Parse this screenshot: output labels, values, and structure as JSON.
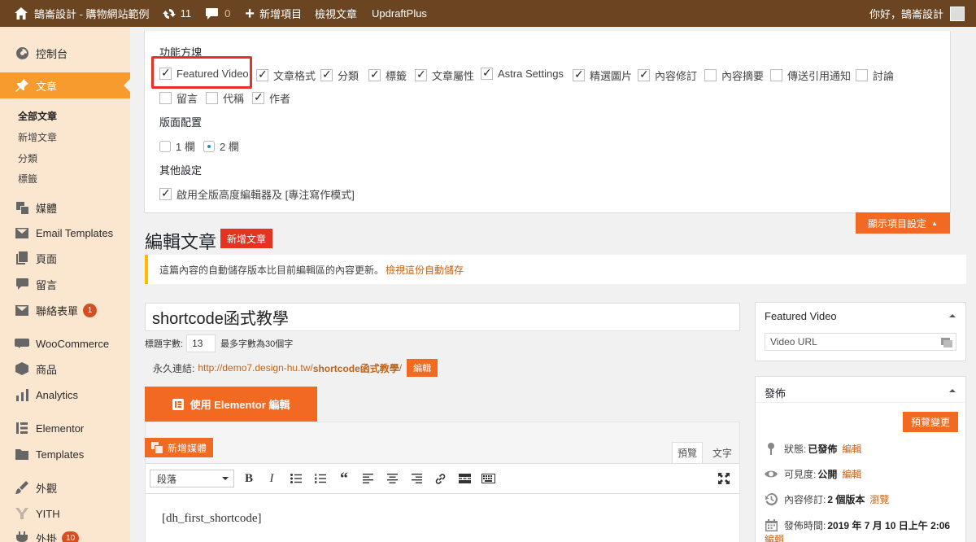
{
  "admin_bar": {
    "site_name": "鵠崙設計 - 購物網站範例",
    "updates_count": "11",
    "comments_count": "0",
    "new_label": "新增項目",
    "view_post_label": "檢視文章",
    "updraft_label": "UpdraftPlus",
    "greeting": "你好，鵠崙設計"
  },
  "sidebar": {
    "items": [
      {
        "label": "控制台",
        "icon": "dashboard-icon"
      },
      {
        "label": "文章",
        "icon": "pin-icon"
      },
      {
        "label": "媒體",
        "icon": "media-icon"
      },
      {
        "label": "Email Templates",
        "icon": "email-icon"
      },
      {
        "label": "頁面",
        "icon": "page-icon"
      },
      {
        "label": "留言",
        "icon": "comment-icon"
      },
      {
        "label": "聯絡表單",
        "icon": "mail-icon",
        "badge": "1"
      },
      {
        "label": "WooCommerce",
        "icon": "woo-icon"
      },
      {
        "label": "商品",
        "icon": "box-icon"
      },
      {
        "label": "Analytics",
        "icon": "bar-chart-icon"
      },
      {
        "label": "Elementor",
        "icon": "elementor-icon"
      },
      {
        "label": "Templates",
        "icon": "folder-icon"
      },
      {
        "label": "外觀",
        "icon": "brush-icon"
      },
      {
        "label": "YITH",
        "icon": "yith-icon"
      },
      {
        "label": "外掛",
        "icon": "plugin-icon",
        "badge": "10"
      }
    ],
    "submenu": [
      "全部文章",
      "新增文章",
      "分類",
      "標籤"
    ]
  },
  "screen_options": {
    "boxes_heading": "功能方塊",
    "boxes": [
      {
        "label": "Featured Video",
        "checked": true
      },
      {
        "label": "文章格式",
        "checked": true
      },
      {
        "label": "分類",
        "checked": true
      },
      {
        "label": "標籤",
        "checked": true
      },
      {
        "label": "文章屬性",
        "checked": true
      },
      {
        "label": "Astra Settings",
        "checked": true
      },
      {
        "label": "精選圖片",
        "checked": true
      },
      {
        "label": "內容修訂",
        "checked": true
      },
      {
        "label": "內容摘要",
        "checked": false
      },
      {
        "label": "傳送引用通知",
        "checked": false
      },
      {
        "label": "討論",
        "checked": false
      },
      {
        "label": "留言",
        "checked": false
      },
      {
        "label": "代稱",
        "checked": false
      },
      {
        "label": "作者",
        "checked": true
      }
    ],
    "layout_heading": "版面配置",
    "layout_options": [
      "1 欄",
      "2 欄"
    ],
    "other_heading": "其他設定",
    "other_option": "啟用全版高度編輯器及 [專注寫作模式]",
    "toggle_label": "顯示項目設定"
  },
  "editor": {
    "page_title": "編輯文章",
    "add_new": "新增文章",
    "notice_text": "這篇內容的自動儲存版本比目前編輯區的內容更新。",
    "notice_link": "檢視這份自動儲存",
    "post_title": "shortcode函式教學",
    "char_count_label": "標題字數:",
    "char_count": "13",
    "char_limit": "最多字數為30個字",
    "permalink_label": "永久連結:",
    "permalink_base": "http://demo7.design-hu.tw/",
    "permalink_slug": "shortcode函式教學",
    "permalink_trail": "/",
    "permalink_edit": "編輯",
    "elementor_button": "使用 Elementor 編輯",
    "add_media": "新增媒體",
    "tab_visual": "預覽",
    "tab_text": "文字",
    "format_select": "段落",
    "content": "[dh_first_shortcode]"
  },
  "featured_video": {
    "title": "Featured Video",
    "placeholder": "Video URL"
  },
  "publish": {
    "title": "發佈",
    "preview_changes": "預覽變更",
    "status_label": "狀態:",
    "status_value": "已發佈",
    "visibility_label": "可見度:",
    "visibility_value": "公開",
    "revisions_label": "內容修訂:",
    "revisions_value": "2 個版本",
    "revisions_link": "瀏覽",
    "published_label": "發佈時間:",
    "published_value": "2019 年 7 月 10 日上午 2:06",
    "edit_link": "編輯"
  },
  "colors": {
    "admin_bar": "#6b4521",
    "sidebar": "#fbe6cf",
    "accent": "#f26a22",
    "active_menu": "#f79b2e",
    "highlight": "#e53222"
  }
}
